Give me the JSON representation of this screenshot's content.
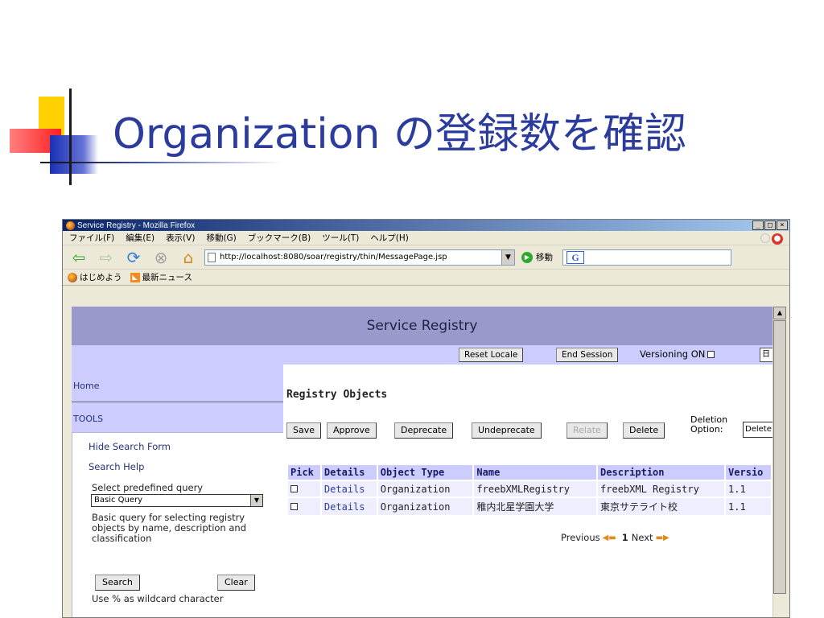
{
  "slide": {
    "title": "Organization の登録数を確認"
  },
  "window": {
    "title": "Service Registry - Mozilla Firefox",
    "buttons": [
      "_",
      "□",
      "×"
    ]
  },
  "menu": [
    "ファイル(F)",
    "編集(E)",
    "表示(V)",
    "移動(G)",
    "ブックマーク(B)",
    "ツール(T)",
    "ヘルプ(H)"
  ],
  "nav": {
    "url": "http://localhost:8080/soar/registry/thin/MessagePage.jsp",
    "go_label": "移動",
    "search_icon": "G"
  },
  "bookmarks": [
    "はじめよう",
    "最新ニュース"
  ],
  "app": {
    "header": "Service Registry",
    "topbar": {
      "reset_locale": "Reset Locale",
      "end_session": "End Session",
      "versioning": "Versioning ON",
      "lang_value": "日"
    },
    "sidebar": {
      "home": "Home",
      "tools": "TOOLS",
      "hide_search": "Hide Search Form",
      "search_help": "Search Help",
      "select_label": "Select predefined query",
      "select_value": "Basic Query",
      "description": "Basic query for selecting registry objects by name, description and classification",
      "search_btn": "Search",
      "clear_btn": "Clear",
      "wildcard_note": "Use % as wildcard character"
    },
    "main": {
      "title": "Registry Objects",
      "actions": [
        "Save",
        "Approve",
        "Deprecate",
        "Undeprecate",
        "Relate",
        "Delete"
      ],
      "deletion_label_1": "Deletion",
      "deletion_label_2": "Option:",
      "deletion_value": "Delete",
      "columns": [
        "Pick",
        "Details",
        "Object Type",
        "Name",
        "Description",
        "Versio"
      ],
      "rows": [
        {
          "details": "Details",
          "type": "Organization",
          "name": "freebXMLRegistry",
          "description": "freebXML Registry",
          "version": "1.1"
        },
        {
          "details": "Details",
          "type": "Organization",
          "name": "稚内北星学園大学",
          "description": "東京サテライト校",
          "version": "1.1"
        }
      ],
      "pager": {
        "previous": "Previous",
        "page": "1",
        "next": "Next"
      }
    }
  }
}
